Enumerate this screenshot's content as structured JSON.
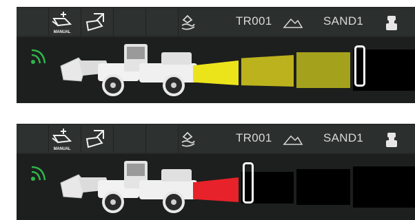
{
  "panels": [
    {
      "id": "top",
      "header": {
        "manual_label": "MANUAL",
        "route_code": "TR001",
        "material": "SAND1"
      },
      "colors": {
        "segment_1": "#ece41b",
        "segment_2": "#bcb21d",
        "segment_3": "#a4a21c",
        "empty_segment": "#000000",
        "wifi": "#2fb54b"
      },
      "payload_level": 0.75
    },
    {
      "id": "bottom",
      "header": {
        "manual_label": "MANUAL",
        "route_code": "TR001",
        "material": "SAND1"
      },
      "colors": {
        "segment_1": "#e8222a",
        "empty_segment": "#000000",
        "wifi": "#2fb54b"
      },
      "payload_level": 0.25
    }
  ],
  "icons": [
    "manual-mode-icon",
    "dump-bucket-icon",
    "hand-load-icon",
    "mountain-stockpile-icon",
    "operator-icon",
    "wireless-signal-icon",
    "loader-vehicle-icon"
  ]
}
